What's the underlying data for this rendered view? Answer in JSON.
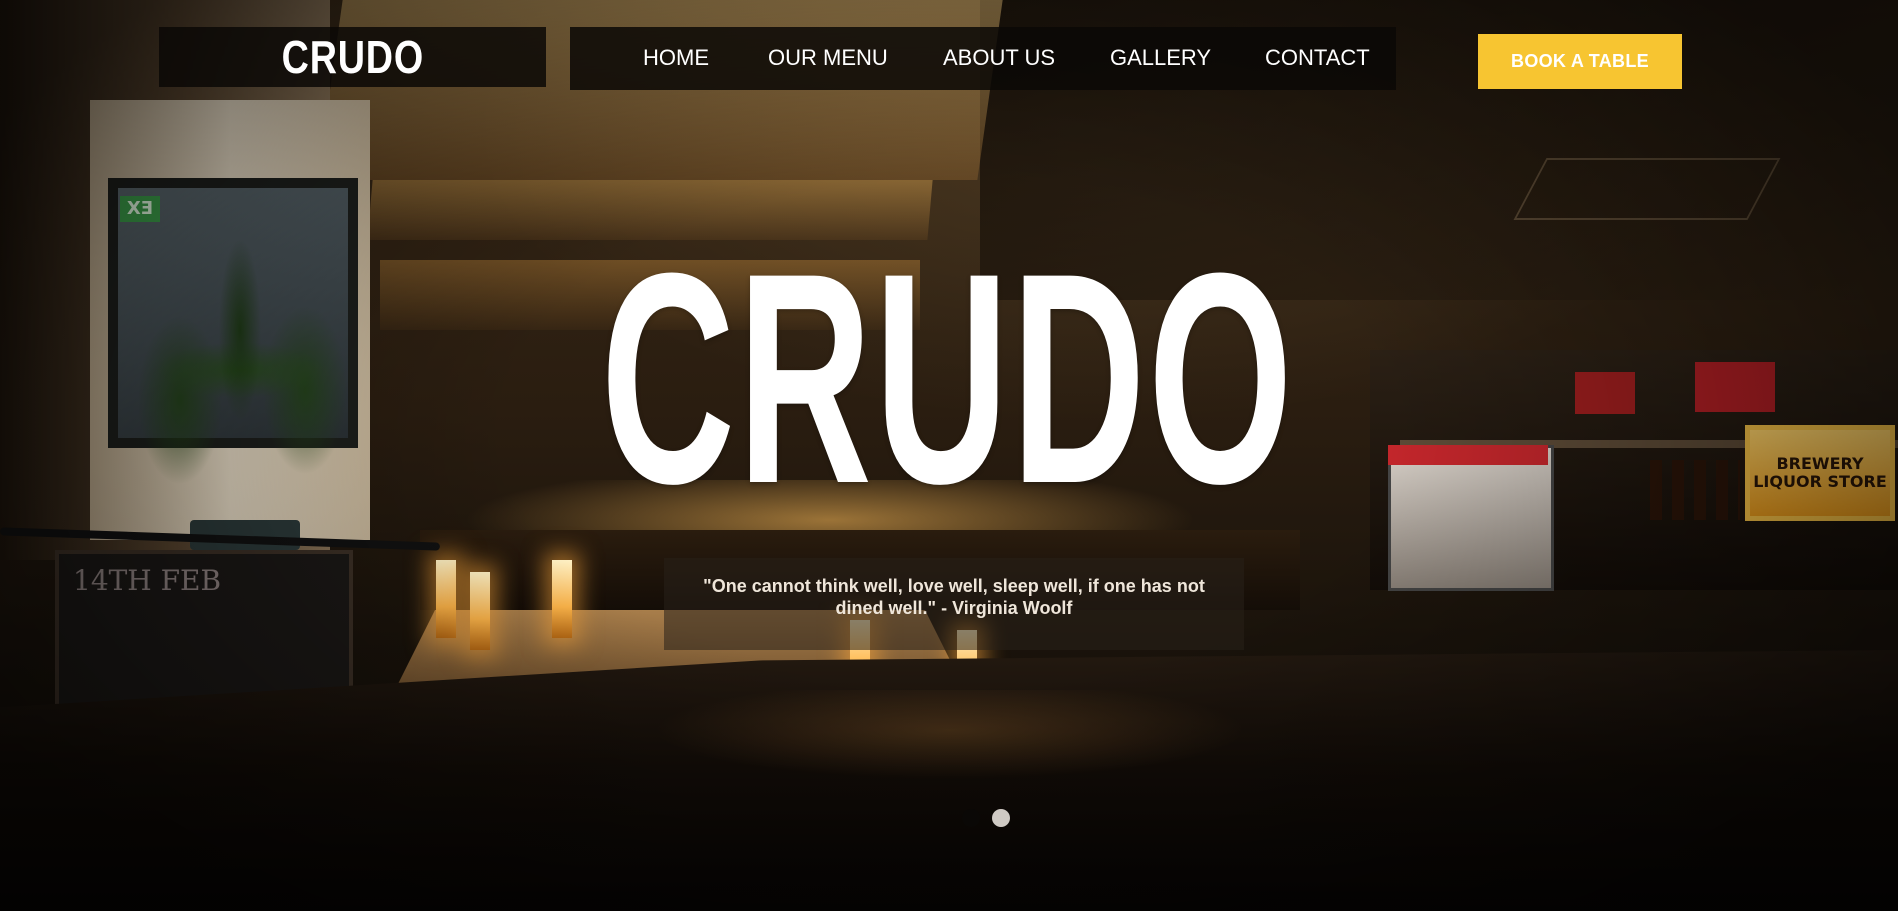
{
  "header": {
    "logo_text": "CRUDO",
    "nav": [
      {
        "label": "HOME"
      },
      {
        "label": "OUR MENU"
      },
      {
        "label": "ABOUT US"
      },
      {
        "label": "GALLERY"
      },
      {
        "label": "CONTACT"
      }
    ],
    "cta_label": "BOOK A TABLE"
  },
  "hero": {
    "title": "CRUDO",
    "quote": "\"One cannot think well, love well, sleep well, if one has not dined well.\" - Virginia Woolf",
    "slides_total": 2,
    "active_slide": 1
  },
  "background": {
    "exit_sign": "EX",
    "brewery_sign": "BREWERY LIQUOR STORE",
    "chalkboard": "14TH FEB"
  },
  "colors": {
    "accent": "#f7c531",
    "nav_bg": "#0a0806",
    "text": "#ffffff"
  }
}
